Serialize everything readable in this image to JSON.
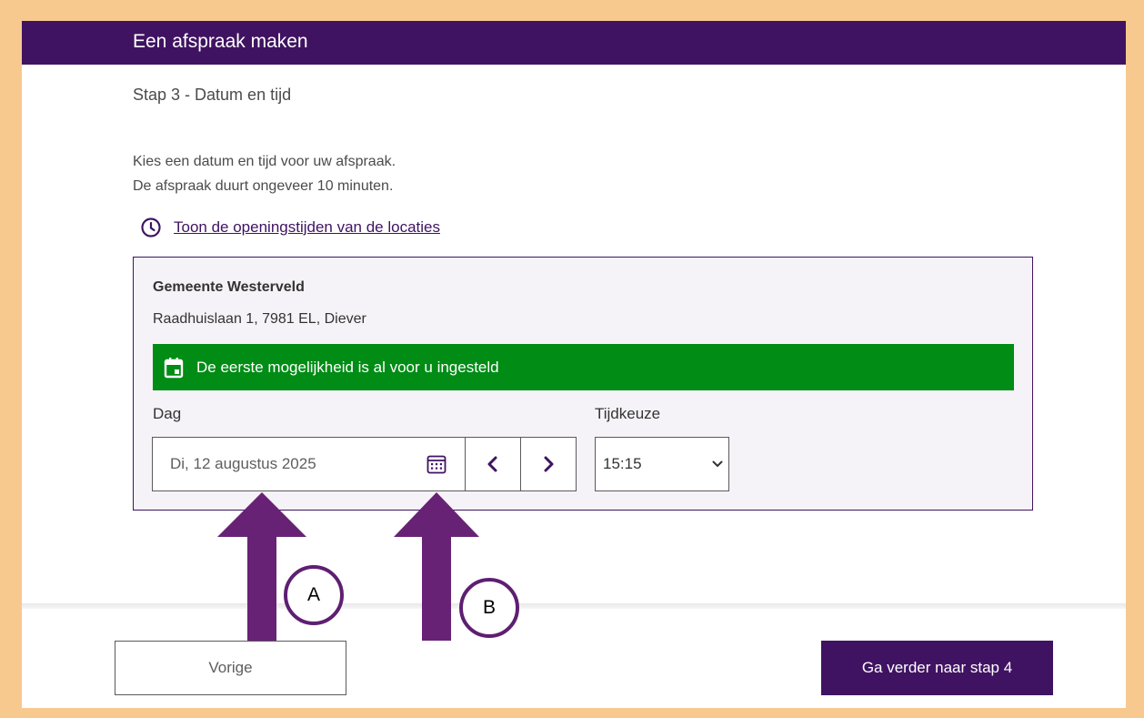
{
  "header": {
    "title": "Een afspraak maken"
  },
  "step": {
    "title": "Stap 3 - Datum en tijd"
  },
  "intro": {
    "line1": "Kies een datum en tijd voor uw afspraak.",
    "line2": "De afspraak duurt ongeveer 10 minuten."
  },
  "hours_link": {
    "label": "Toon de openingstijden van de locaties",
    "icon": "clock-icon"
  },
  "location": {
    "name": "Gemeente Westerveld",
    "address": "Raadhuislaan 1, 7981 EL, Diever"
  },
  "notice": {
    "text": "De eerste mogelijkheid is al voor u ingesteld",
    "icon": "calendar-icon"
  },
  "day_field": {
    "label": "Dag",
    "value": "Di, 12 augustus 2025",
    "calendar_icon": "calendar-grid-icon",
    "prev_icon": "chevron-left-icon",
    "next_icon": "chevron-right-icon"
  },
  "time_field": {
    "label": "Tijdkeuze",
    "value": "15:15"
  },
  "footer": {
    "prev_label": "Vorige",
    "next_label": "Ga verder naar stap 4"
  },
  "annotations": {
    "marker_a": "A",
    "marker_b": "B"
  },
  "colors": {
    "brand": "#3f1361",
    "notice": "#008c15",
    "frame": "#f7c98e",
    "arrow": "#682275"
  }
}
